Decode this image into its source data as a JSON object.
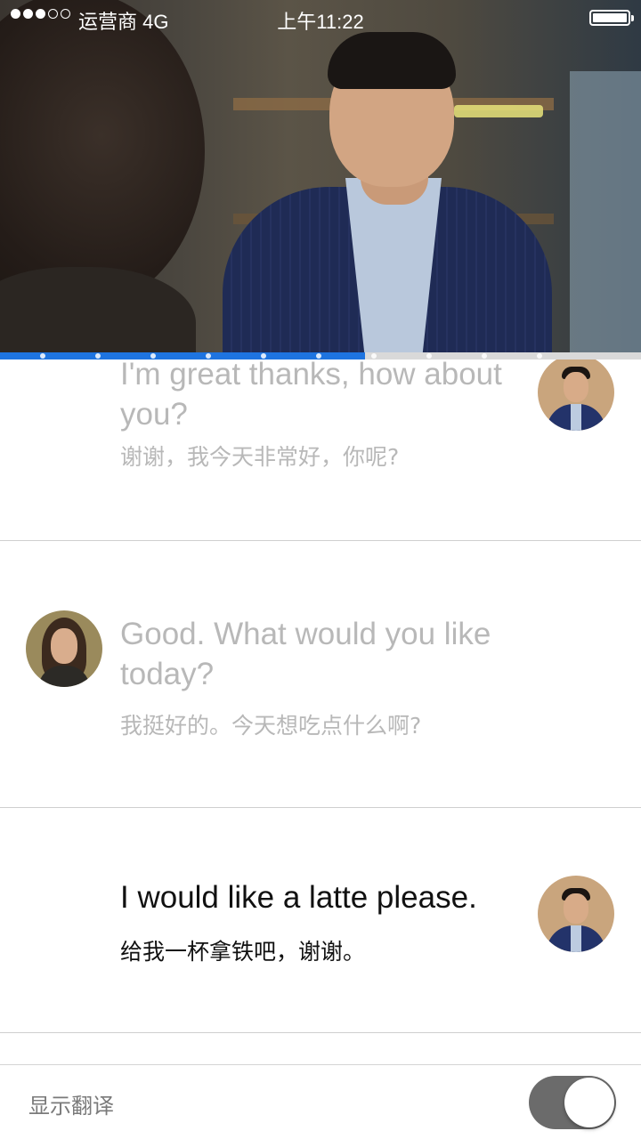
{
  "status_bar": {
    "signal_bars_filled": 3,
    "signal_bars_total": 5,
    "carrier": "运营商 4G",
    "time": "上午11:22",
    "battery_icon": "battery-full-icon"
  },
  "video": {
    "progress_fraction": 0.57,
    "progress_color": "#1e74e0",
    "segment_markers": 10
  },
  "messages": [
    {
      "speaker": "man",
      "english": "I'm great thanks, how about you?",
      "chinese": "谢谢，我今天非常好，你呢?",
      "state": "past"
    },
    {
      "speaker": "woman",
      "english": "Good. What would you like today?",
      "chinese": "我挺好的。今天想吃点什么啊?",
      "state": "past"
    },
    {
      "speaker": "man",
      "english": "I would like a latte please.",
      "chinese": "给我一杯拿铁吧，谢谢。",
      "state": "current"
    }
  ],
  "bottom_bar": {
    "show_translation_label": "显示翻译",
    "toggle_on": true
  }
}
